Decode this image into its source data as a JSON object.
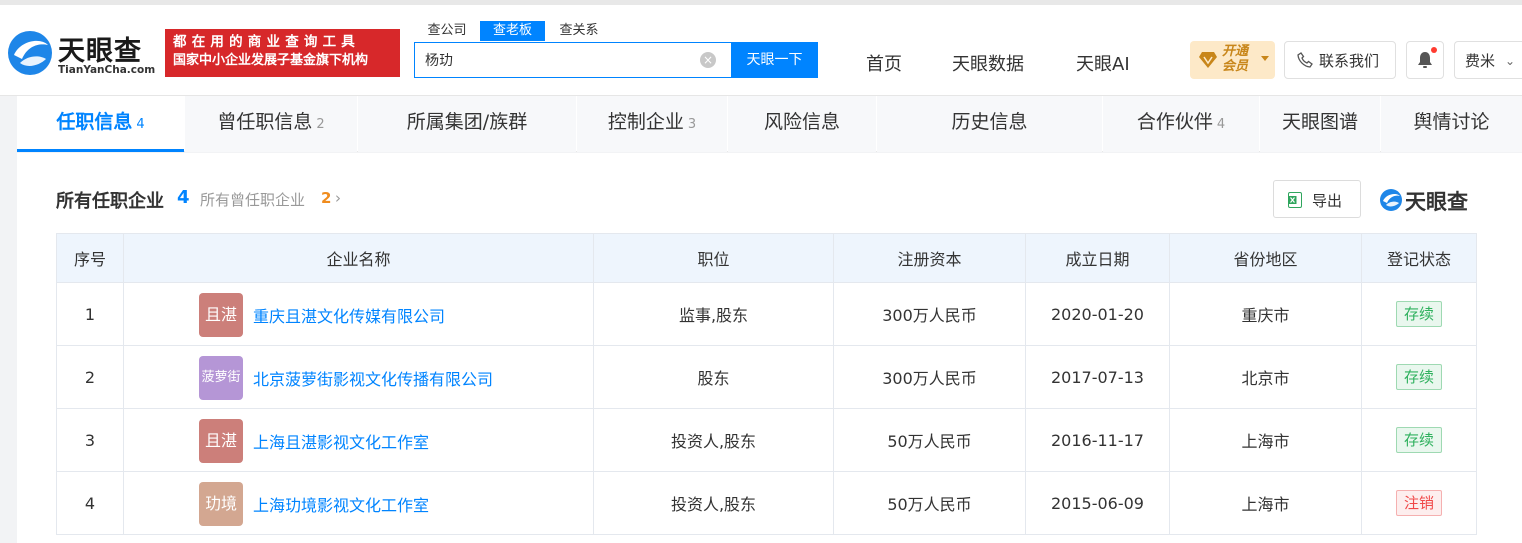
{
  "brand": {
    "name": "天眼查",
    "domain": "TianYanCha.com"
  },
  "slogan": {
    "line1": "都在用的商业查询工具",
    "line2": "国家中小企业发展子基金旗下机构"
  },
  "search": {
    "tabs": [
      "查公司",
      "查老板",
      "查关系"
    ],
    "active_tab": "查老板",
    "query": "杨玏",
    "button": "天眼一下"
  },
  "nav": {
    "home": "首页",
    "data": "天眼数据",
    "ai": "天眼AI"
  },
  "vip": {
    "line1": "开通",
    "line2": "会员"
  },
  "contact": "联系我们",
  "user": "费米",
  "tabs": [
    {
      "label": "任职信息",
      "count": "4"
    },
    {
      "label": "曾任职信息",
      "count": "2"
    },
    {
      "label": "所属集团/族群",
      "count": ""
    },
    {
      "label": "控制企业",
      "count": "3"
    },
    {
      "label": "风险信息",
      "count": ""
    },
    {
      "label": "历史信息",
      "count": ""
    },
    {
      "label": "合作伙伴",
      "count": "4"
    },
    {
      "label": "天眼图谱",
      "count": ""
    },
    {
      "label": "舆情讨论",
      "count": ""
    }
  ],
  "section": {
    "title": "所有任职企业",
    "count": "4",
    "link": "所有曾任职企业",
    "link_count": "2",
    "export": "导出",
    "watermark": "天眼查"
  },
  "table": {
    "headers": [
      "序号",
      "企业名称",
      "职位",
      "注册资本",
      "成立日期",
      "省份地区",
      "登记状态"
    ],
    "rows": [
      {
        "no": "1",
        "avatar": "且湛",
        "avatar_color": "#cc7f7a",
        "name": "重庆且湛文化传媒有限公司",
        "role": "监事,股东",
        "capital": "300万人民币",
        "date": "2020-01-20",
        "region": "重庆市",
        "status": "存续",
        "status_type": "ok"
      },
      {
        "no": "2",
        "avatar": "菠萝街",
        "avatar_color": "#b596d6",
        "name": "北京菠萝街影视文化传播有限公司",
        "role": "股东",
        "capital": "300万人民币",
        "date": "2017-07-13",
        "region": "北京市",
        "status": "存续",
        "status_type": "ok"
      },
      {
        "no": "3",
        "avatar": "且湛",
        "avatar_color": "#cc7f7a",
        "name": "上海且湛影视文化工作室",
        "role": "投资人,股东",
        "capital": "50万人民币",
        "date": "2016-11-17",
        "region": "上海市",
        "status": "存续",
        "status_type": "ok"
      },
      {
        "no": "4",
        "avatar": "玏境",
        "avatar_color": "#d3a791",
        "name": "上海玏境影视文化工作室",
        "role": "投资人,股东",
        "capital": "50万人民币",
        "date": "2015-06-09",
        "region": "上海市",
        "status": "注销",
        "status_type": "bad"
      }
    ]
  },
  "colors": {
    "accent": "#0084ff",
    "slogan_bg": "#d7282a",
    "status_ok": "#2fb15e",
    "status_bad": "#f04848"
  }
}
